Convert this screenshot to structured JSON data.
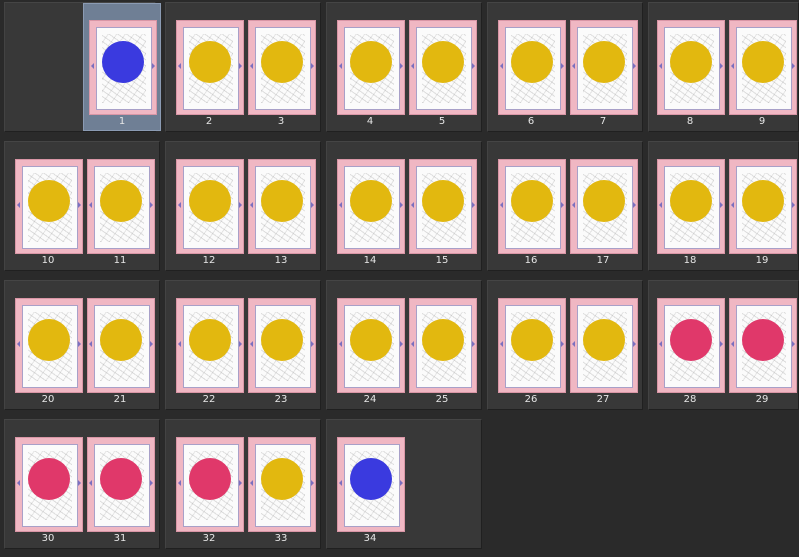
{
  "pages": [
    {
      "n": "1",
      "dot": "blue",
      "selected": true
    },
    {
      "n": "2",
      "dot": "yellow"
    },
    {
      "n": "3",
      "dot": "yellow"
    },
    {
      "n": "4",
      "dot": "yellow"
    },
    {
      "n": "5",
      "dot": "yellow"
    },
    {
      "n": "6",
      "dot": "yellow"
    },
    {
      "n": "7",
      "dot": "yellow"
    },
    {
      "n": "8",
      "dot": "yellow"
    },
    {
      "n": "9",
      "dot": "yellow"
    },
    {
      "n": "10",
      "dot": "yellow"
    },
    {
      "n": "11",
      "dot": "yellow"
    },
    {
      "n": "12",
      "dot": "yellow"
    },
    {
      "n": "13",
      "dot": "yellow"
    },
    {
      "n": "14",
      "dot": "yellow"
    },
    {
      "n": "15",
      "dot": "yellow"
    },
    {
      "n": "16",
      "dot": "yellow"
    },
    {
      "n": "17",
      "dot": "yellow"
    },
    {
      "n": "18",
      "dot": "yellow"
    },
    {
      "n": "19",
      "dot": "yellow"
    },
    {
      "n": "20",
      "dot": "yellow"
    },
    {
      "n": "21",
      "dot": "yellow"
    },
    {
      "n": "22",
      "dot": "yellow"
    },
    {
      "n": "23",
      "dot": "yellow"
    },
    {
      "n": "24",
      "dot": "yellow"
    },
    {
      "n": "25",
      "dot": "yellow"
    },
    {
      "n": "26",
      "dot": "yellow"
    },
    {
      "n": "27",
      "dot": "yellow"
    },
    {
      "n": "28",
      "dot": "red"
    },
    {
      "n": "29",
      "dot": "red"
    },
    {
      "n": "30",
      "dot": "red"
    },
    {
      "n": "31",
      "dot": "red"
    },
    {
      "n": "32",
      "dot": "red"
    },
    {
      "n": "33",
      "dot": "yellow"
    },
    {
      "n": "34",
      "dot": "blue"
    }
  ],
  "colors": {
    "yellow": "#e2b80f",
    "red": "#e0386a",
    "blue": "#3a3adf",
    "selection": "#6f7f95"
  }
}
